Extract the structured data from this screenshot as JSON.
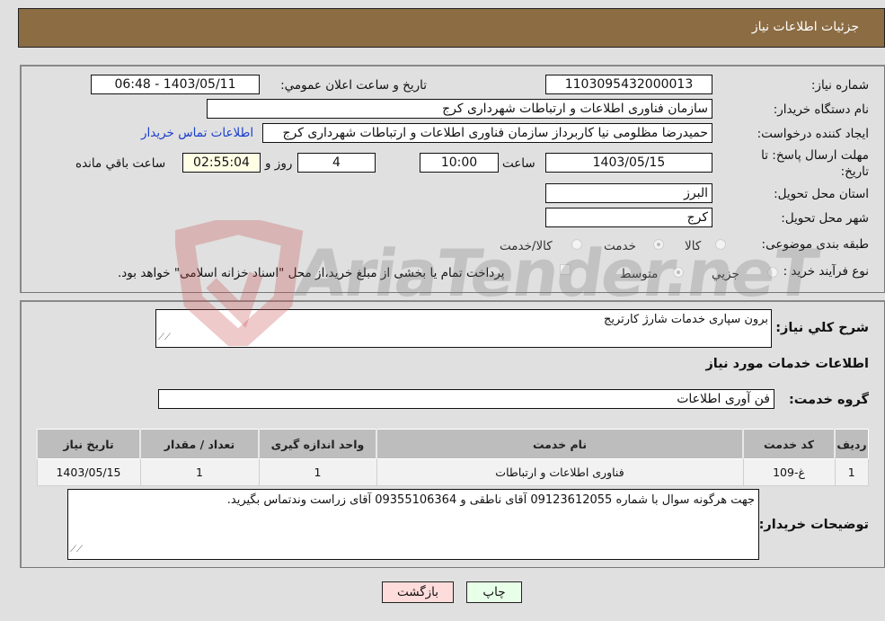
{
  "header": {
    "title": "جزئیات اطلاعات نیاز"
  },
  "details": {
    "need_number_label": "شماره نیاز:",
    "need_number": "1103095432000013",
    "announce_label": "تاریخ و ساعت اعلان عمومي:",
    "announce_value": "1403/05/11 - 06:48",
    "buyer_org_label": "نام دستگاه خریدار:",
    "buyer_org": "سازمان فناوری اطلاعات و ارتباطات شهرداری کرج",
    "requester_label": "ایجاد کننده درخواست:",
    "requester": "حمیدرضا مظلومی نیا کاربرداز سازمان فناوری اطلاعات و ارتباطات شهرداری کرج",
    "contact_link": "اطلاعات تماس خریدار",
    "deadline_label": "مهلت ارسال پاسخ: تا تاریخ:",
    "deadline_date": "1403/05/15",
    "time_label": "ساعت",
    "deadline_time": "10:00",
    "days_value": "4",
    "days_label": "روز و",
    "remaining_value": "02:55:04",
    "remaining_label": "ساعت باقي مانده",
    "province_label": "استان محل تحویل:",
    "province": "البرز",
    "city_label": "شهر محل تحویل:",
    "city": "کرج",
    "category_label": "طبقه بندی موضوعی:",
    "category_options": [
      {
        "label": "کالا",
        "checked": false
      },
      {
        "label": "خدمت",
        "checked": true
      },
      {
        "label": "کالا/خدمت",
        "checked": false
      }
    ],
    "process_label": "نوع فرآیند خرید :",
    "process_options": [
      {
        "label": "جزیي",
        "checked": false
      },
      {
        "label": "متوسط",
        "checked": true
      }
    ],
    "treasury_note": "پرداخت تمام یا بخشی از مبلغ خرید،از محل \"اسناد خزانه اسلامی\" خواهد بود.",
    "treasury_checked": false
  },
  "summary": {
    "description_label": "شرح کلي نیاز:",
    "description": "برون سپاری خدمات شارژ کارتریج",
    "services_heading": "اطلاعات خدمات مورد نیاز",
    "service_group_label": "گروه خدمت:",
    "service_group": "فن آوری اطلاعات"
  },
  "table": {
    "headers": [
      "ردیف",
      "کد خدمت",
      "نام خدمت",
      "واحد اندازه گیری",
      "تعداد / مقدار",
      "تاریخ نیاز"
    ],
    "rows": [
      [
        "1",
        "غ-109",
        "فناوری اطلاعات و ارتباطات",
        "1",
        "1",
        "1403/05/15"
      ]
    ]
  },
  "buyer_notes": {
    "label": "توضیحات خریدار:",
    "text": "جهت هرگونه سوال با شماره 09123612055 آقای ناطقی و 09355106364 آقای زراست وندتماس بگیرید."
  },
  "buttons": {
    "print": "چاپ",
    "back": "بازگشت"
  },
  "watermark": {
    "text": "AriaTender.neT"
  }
}
